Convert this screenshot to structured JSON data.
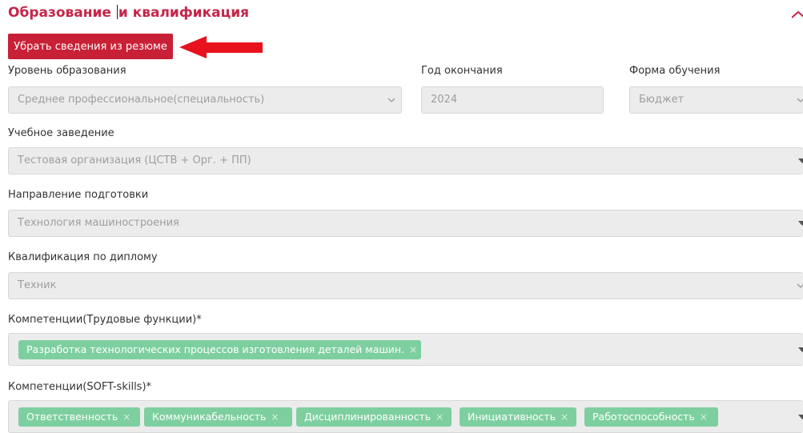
{
  "section": {
    "title_part1": "Образование",
    "title_part2": "и квалификация"
  },
  "remove_button": "Убрать сведения из резюме",
  "education_level": {
    "label": "Уровень образования",
    "value": "Среднее профессиональное(специальность)"
  },
  "graduation_year": {
    "label": "Год окончания",
    "value": "2024"
  },
  "study_form": {
    "label": "Форма обучения",
    "value": "Бюджет"
  },
  "institution": {
    "label": "Учебное заведение",
    "value": "Тестовая организация (ЦСТВ + Орг. + ПП)"
  },
  "direction": {
    "label": "Направление подготовки",
    "value": "Технология машиностроения"
  },
  "qualification": {
    "label": "Квалификация по диплому",
    "value": "Техник"
  },
  "labor_functions": {
    "label": "Компетенции(Трудовые функции)*",
    "tags": [
      {
        "text": "Разработка технологических процессов изготовления деталей машин.",
        "remove": "×"
      }
    ]
  },
  "soft_skills": {
    "label": "Компетенции(SOFT-skills)*",
    "tags": [
      {
        "text": "Ответственность",
        "remove": "×"
      },
      {
        "text": "Коммуникабельность",
        "remove": "×"
      },
      {
        "text": "Дисциплинированность",
        "remove": "×"
      },
      {
        "text": "Инициативность",
        "remove": "×"
      },
      {
        "text": "Работоспособность",
        "remove": "×"
      }
    ]
  },
  "colors": {
    "title": "#c4264a",
    "button": "#c82036",
    "arrow": "#e8111e",
    "tag": "#7ecfa0",
    "field_bg": "#ececec"
  },
  "icons": {
    "collapse": "chevron-up-icon",
    "arrow": "red-arrow-left-icon",
    "dropdown": "chevron-down-icon"
  }
}
